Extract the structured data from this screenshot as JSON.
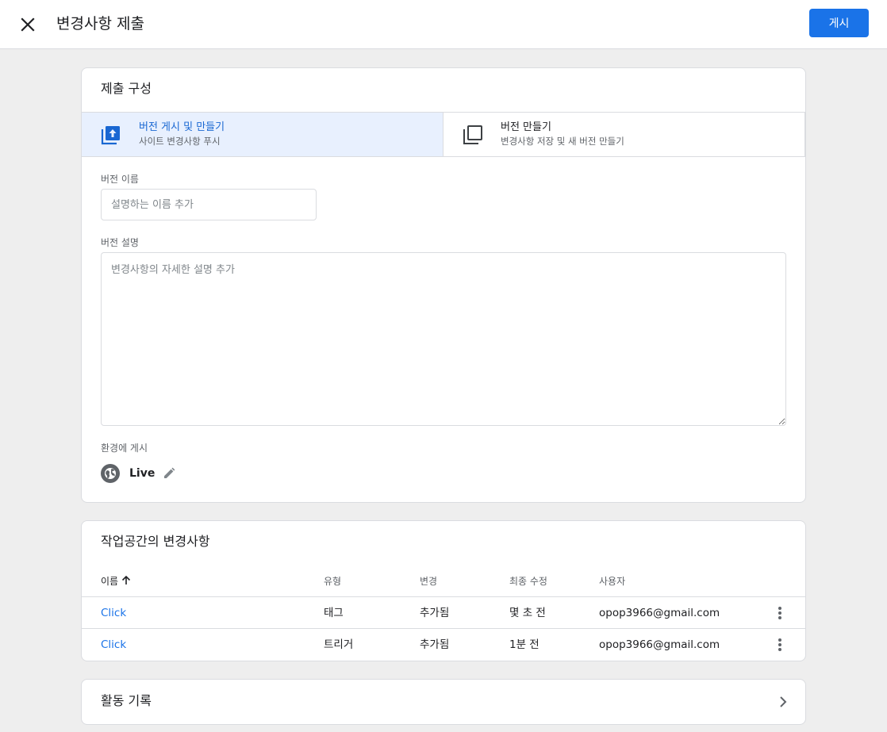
{
  "header": {
    "title": "변경사항 제출",
    "publish_label": "게시"
  },
  "submission": {
    "title": "제출 구성",
    "options": [
      {
        "title": "버전 게시 및 만들기",
        "subtitle": "사이트 변경사항 푸시",
        "selected": true,
        "icon": "publish-upload-icon"
      },
      {
        "title": "버전 만들기",
        "subtitle": "변경사항 저장 및 새 버전 만들기",
        "selected": false,
        "icon": "copy-version-icon"
      }
    ],
    "version_name_label": "버전 이름",
    "version_name_placeholder": "설명하는 이름 추가",
    "version_name_value": "",
    "version_desc_label": "버전 설명",
    "version_desc_placeholder": "변경사항의 자세한 설명 추가",
    "version_desc_value": "",
    "env_label": "환경에 게시",
    "env_name": "Live"
  },
  "changes": {
    "title": "작업공간의 변경사항",
    "columns": [
      "이름",
      "유형",
      "변경",
      "최종 수정",
      "사용자"
    ],
    "sort_icon": "arrow-up-icon",
    "rows": [
      {
        "name": "Click",
        "type": "태그",
        "change": "추가됨",
        "modified": "몇 초 전",
        "user": "opop3966@gmail.com"
      },
      {
        "name": "Click",
        "type": "트리거",
        "change": "추가됨",
        "modified": "1분 전",
        "user": "opop3966@gmail.com"
      }
    ]
  },
  "activity": {
    "title": "활동 기록"
  },
  "colors": {
    "accent": "#1a73e8",
    "selected_bg": "#e8f0fe",
    "background": "#eeeeee"
  }
}
